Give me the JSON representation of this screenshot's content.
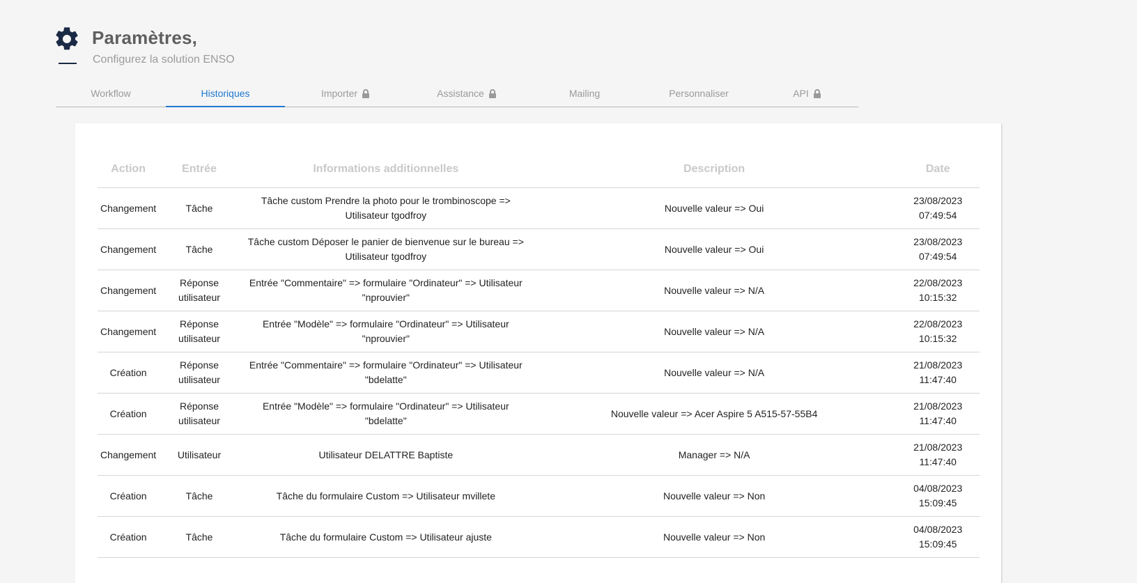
{
  "header": {
    "title": "Paramètres,",
    "subtitle": "Configurez la solution ENSO",
    "icon": "gear-icon",
    "icon_color": "#1b2a44"
  },
  "tabs": [
    {
      "label": "Workflow",
      "locked": false,
      "active": false
    },
    {
      "label": "Historiques",
      "locked": false,
      "active": true
    },
    {
      "label": "Importer",
      "locked": true,
      "active": false
    },
    {
      "label": "Assistance",
      "locked": true,
      "active": false
    },
    {
      "label": "Mailing",
      "locked": false,
      "active": false
    },
    {
      "label": "Personnaliser",
      "locked": false,
      "active": false
    },
    {
      "label": "API",
      "locked": true,
      "active": false
    }
  ],
  "colors": {
    "accent": "#1f78d1",
    "muted_text": "#9a9a9a"
  },
  "table": {
    "columns": [
      "Action",
      "Entrée",
      "Informations additionnelles",
      "Description",
      "Date"
    ],
    "rows": [
      {
        "action": "Changement",
        "entry": "Tâche",
        "info": "Tâche custom Prendre la photo pour le trombinoscope => Utilisateur tgodfroy",
        "description": "Nouvelle valeur => Oui",
        "date": "23/08/2023 07:49:54"
      },
      {
        "action": "Changement",
        "entry": "Tâche",
        "info": "Tâche custom Déposer le panier de bienvenue sur le bureau => Utilisateur tgodfroy",
        "description": "Nouvelle valeur => Oui",
        "date": "23/08/2023 07:49:54"
      },
      {
        "action": "Changement",
        "entry": "Réponse utilisateur",
        "info": "Entrée \"Commentaire\" => formulaire \"Ordinateur\" => Utilisateur \"nprouvier\"",
        "description": "Nouvelle valeur => N/A",
        "date": "22/08/2023 10:15:32"
      },
      {
        "action": "Changement",
        "entry": "Réponse utilisateur",
        "info": "Entrée \"Modèle\" => formulaire \"Ordinateur\" => Utilisateur \"nprouvier\"",
        "description": "Nouvelle valeur => N/A",
        "date": "22/08/2023 10:15:32"
      },
      {
        "action": "Création",
        "entry": "Réponse utilisateur",
        "info": "Entrée \"Commentaire\" => formulaire \"Ordinateur\" => Utilisateur \"bdelatte\"",
        "description": "Nouvelle valeur => N/A",
        "date": "21/08/2023 11:47:40"
      },
      {
        "action": "Création",
        "entry": "Réponse utilisateur",
        "info": "Entrée \"Modèle\" => formulaire \"Ordinateur\" => Utilisateur \"bdelatte\"",
        "description": "Nouvelle valeur => Acer Aspire 5 A515-57-55B4",
        "date": "21/08/2023 11:47:40"
      },
      {
        "action": "Changement",
        "entry": "Utilisateur",
        "info": "Utilisateur DELATTRE Baptiste",
        "description": "Manager => N/A",
        "date": "21/08/2023 11:47:40"
      },
      {
        "action": "Création",
        "entry": "Tâche",
        "info": "Tâche du formulaire Custom => Utilisateur mvillete",
        "description": "Nouvelle valeur => Non",
        "date": "04/08/2023 15:09:45"
      },
      {
        "action": "Création",
        "entry": "Tâche",
        "info": "Tâche du formulaire Custom => Utilisateur ajuste",
        "description": "Nouvelle valeur => Non",
        "date": "04/08/2023 15:09:45"
      }
    ]
  }
}
